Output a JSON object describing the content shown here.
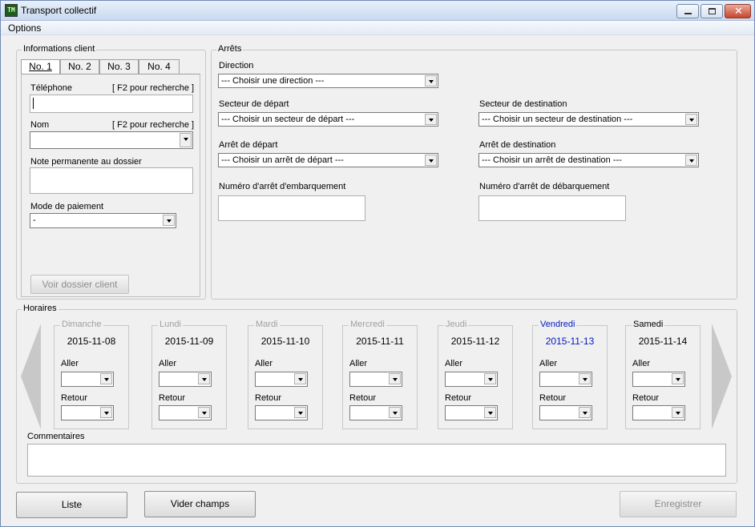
{
  "window": {
    "title": "Transport collectif",
    "icon_text": "TM"
  },
  "menu": {
    "options": "Options"
  },
  "client": {
    "legend": "Informations client",
    "tabs": [
      "No. 1",
      "No. 2",
      "No. 3",
      "No. 4"
    ],
    "phone_label": "Téléphone",
    "phone_hint": "[ F2 pour recherche ]",
    "phone_value": "",
    "name_label": "Nom",
    "name_hint": "[ F2 pour recherche ]",
    "name_value": "",
    "note_label": "Note permanente au dossier",
    "note_value": "",
    "payment_label": "Mode de paiement",
    "payment_value": "-",
    "view_button": "Voir dossier client"
  },
  "stops": {
    "legend": "Arrêts",
    "direction_label": "Direction",
    "direction_value": "--- Choisir une direction ---",
    "dep_sector_label": "Secteur de départ",
    "dep_sector_value": "--- Choisir un secteur de départ ---",
    "dest_sector_label": "Secteur de destination",
    "dest_sector_value": "--- Choisir un secteur de destination ---",
    "dep_stop_label": "Arrêt de départ",
    "dep_stop_value": "--- Choisir un arrêt de départ ---",
    "dest_stop_label": "Arrêt de destination",
    "dest_stop_value": "--- Choisir un arrêt de destination ---",
    "board_label": "Numéro d'arrêt d'embarquement",
    "board_value": "",
    "alight_label": "Numéro d'arrêt de débarquement",
    "alight_value": ""
  },
  "schedule": {
    "legend": "Horaires",
    "go_label": "Aller",
    "return_label": "Retour",
    "days": [
      {
        "name": "Dimanche",
        "date": "2015-11-08"
      },
      {
        "name": "Lundi",
        "date": "2015-11-09"
      },
      {
        "name": "Mardi",
        "date": "2015-11-10"
      },
      {
        "name": "Mercredi",
        "date": "2015-11-11"
      },
      {
        "name": "Jeudi",
        "date": "2015-11-12"
      },
      {
        "name": "Vendredi",
        "date": "2015-11-13"
      },
      {
        "name": "Samedi",
        "date": "2015-11-14"
      }
    ],
    "comments_label": "Commentaires",
    "comments_value": ""
  },
  "actions": {
    "list": "Liste",
    "clear": "Vider champs",
    "save": "Enregistrer"
  },
  "colors": {
    "selected_day": "#0018c0",
    "disabled_text": "#8d8d8d"
  }
}
